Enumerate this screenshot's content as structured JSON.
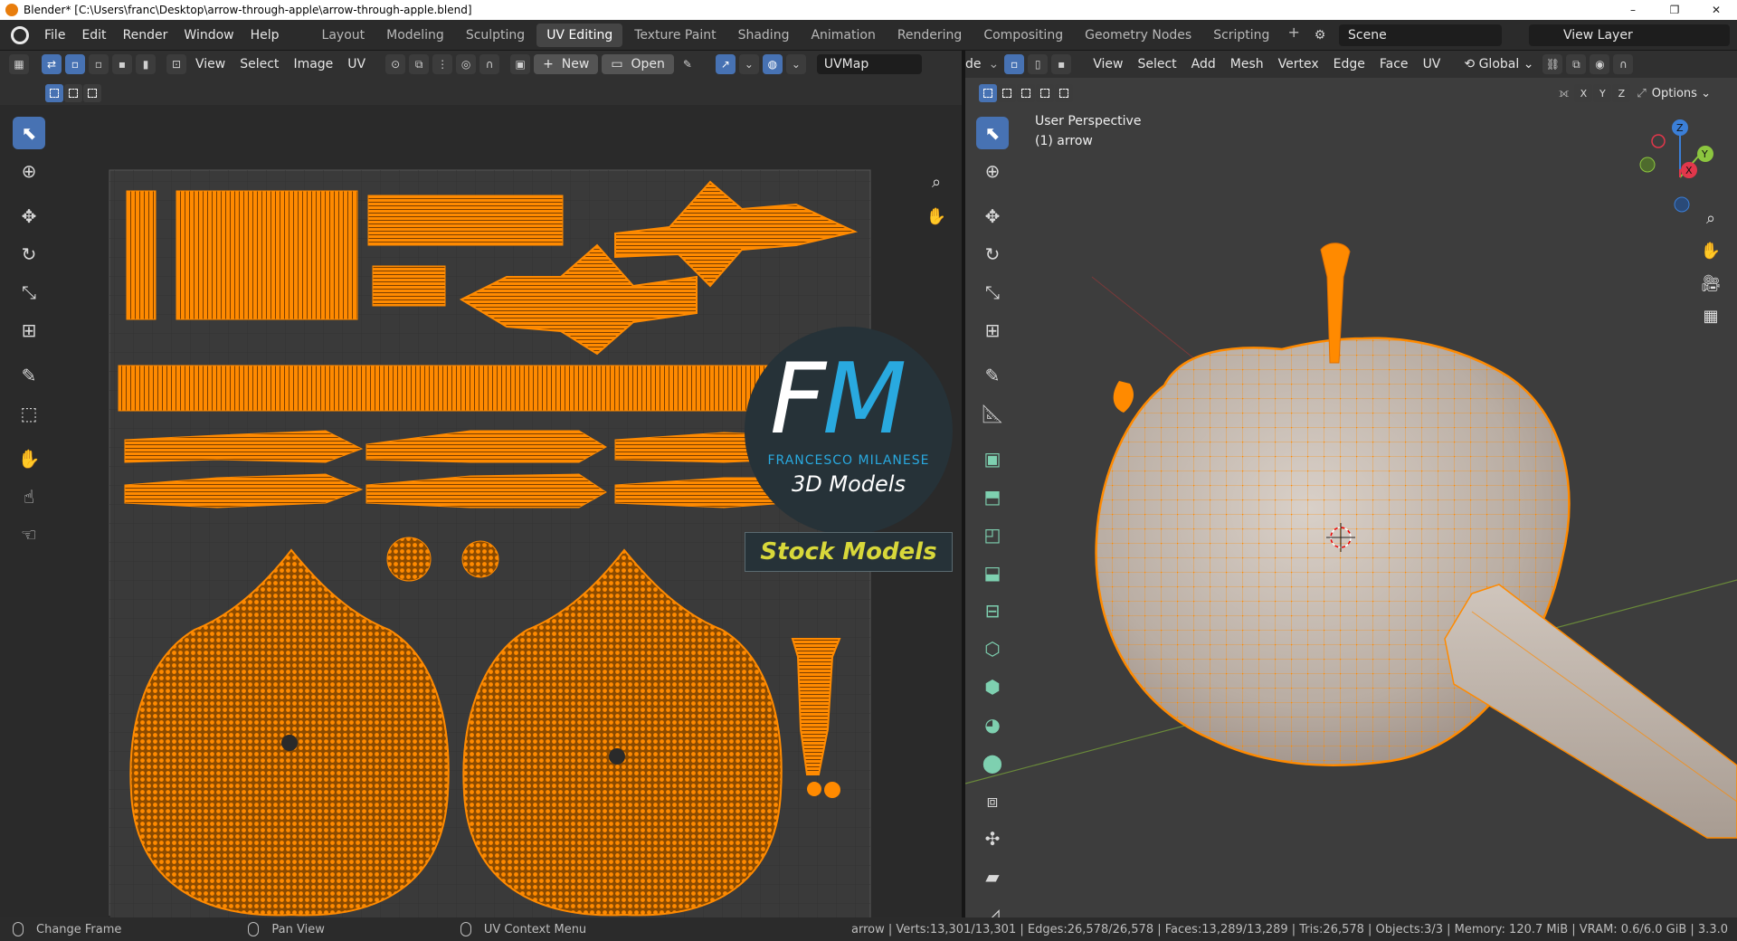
{
  "window": {
    "title": "Blender* [C:\\Users\\franc\\Desktop\\arrow-through-apple\\arrow-through-apple.blend]",
    "controls": [
      "–",
      "❐",
      "✕"
    ]
  },
  "menu": [
    "File",
    "Edit",
    "Render",
    "Window",
    "Help"
  ],
  "workspaces": [
    "Layout",
    "Modeling",
    "Sculpting",
    "UV Editing",
    "Texture Paint",
    "Shading",
    "Animation",
    "Rendering",
    "Compositing",
    "Geometry Nodes",
    "Scripting"
  ],
  "active_workspace": "UV Editing",
  "scene": "Scene",
  "view_layer": "View Layer",
  "uv_header": {
    "menus": [
      "View",
      "Select",
      "Image",
      "UV"
    ],
    "new_label": "New",
    "open_label": "Open",
    "uvmap": "UVMap"
  },
  "vp_header": {
    "mode": "de",
    "menus": [
      "View",
      "Select",
      "Add",
      "Mesh",
      "Vertex",
      "Edge",
      "Face",
      "UV"
    ],
    "orientation": "Global",
    "axes": [
      "X",
      "Y",
      "Z"
    ],
    "options_label": "Options"
  },
  "viewport": {
    "perspective": "User Perspective",
    "object": "(1) arrow"
  },
  "watermark": {
    "letters_f": "F",
    "letters_m": "M",
    "name": "FRANCESCO MILANESE",
    "sub": "3D Models",
    "stock": "Stock Models"
  },
  "status": {
    "hints": [
      "Change Frame",
      "Pan View",
      "UV Context Menu"
    ],
    "stats": "arrow | Verts:13,301/13,301 | Edges:26,578/26,578 | Faces:13,289/13,289 | Tris:26,578 | Objects:3/3 | Memory: 120.7 MiB | VRAM: 0.6/6.0 GiB | 3.3.0"
  },
  "colors": {
    "accent": "#4772b3",
    "selection": "#ff8a00",
    "mesh": "#bdb3ab"
  }
}
